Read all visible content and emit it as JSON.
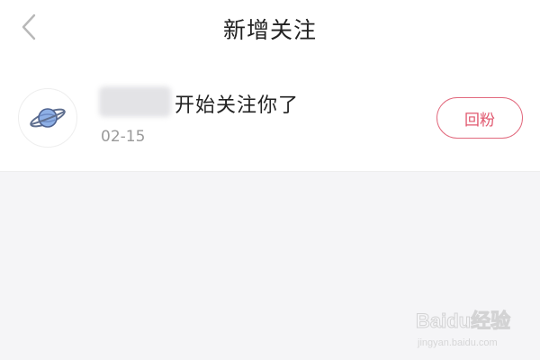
{
  "header": {
    "title": "新增关注",
    "back_icon": "chevron-left-icon"
  },
  "notifications": [
    {
      "username": "",
      "action": "开始关注你了",
      "date": "02-15",
      "button_label": "回粉",
      "avatar_icon": "planet-icon"
    }
  ],
  "watermark": {
    "brand": "Baidu经验",
    "url": "jingyan.baidu.com"
  },
  "colors": {
    "accent": "#e0576e",
    "background": "#f5f5f7",
    "planet": "#7fa4e0"
  }
}
